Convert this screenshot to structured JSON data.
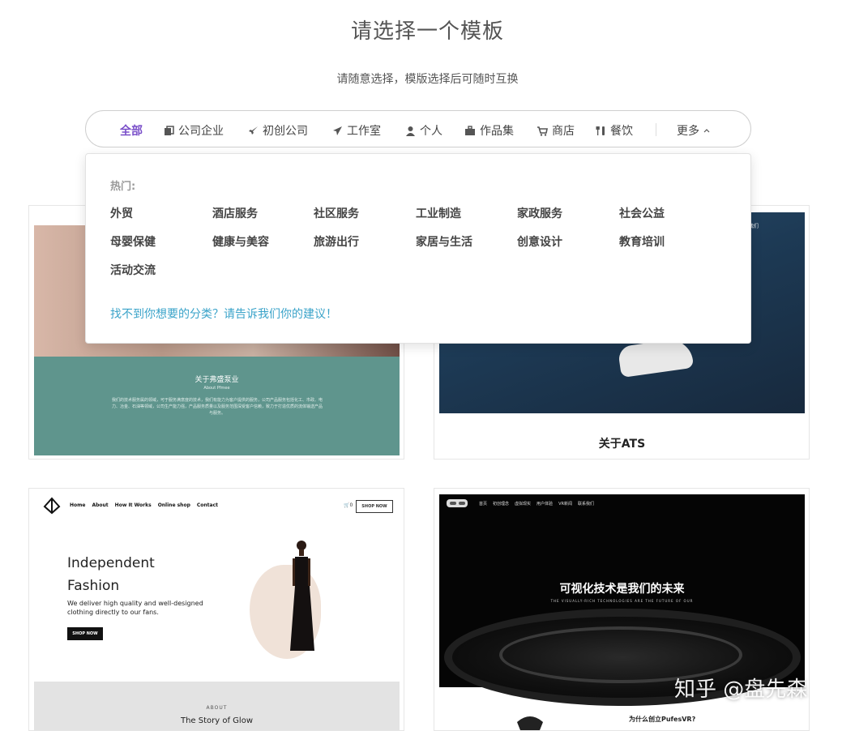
{
  "header": {
    "title": "请选择一个模板",
    "subtitle": "请随意选择，模版选择后可随时互换"
  },
  "category_bar": {
    "items": [
      {
        "label": "全部",
        "icon": "none",
        "active": true
      },
      {
        "label": "公司企业",
        "icon": "copy-icon"
      },
      {
        "label": "初创公司",
        "icon": "rocket-icon"
      },
      {
        "label": "工作室",
        "icon": "paper-plane-icon"
      },
      {
        "label": "个人",
        "icon": "user-icon"
      },
      {
        "label": "作品集",
        "icon": "briefcase-icon"
      },
      {
        "label": "商店",
        "icon": "cart-icon"
      },
      {
        "label": "餐饮",
        "icon": "cutlery-icon"
      }
    ],
    "more": "更多",
    "accent_color": "#7a4fc9"
  },
  "dropdown": {
    "hot_label": "热门:",
    "industries": [
      "外贸",
      "酒店服务",
      "社区服务",
      "工业制造",
      "家政服务",
      "社会公益",
      "母婴保健",
      "健康与美容",
      "旅游出行",
      "家居与生活",
      "创意设计",
      "教育培训",
      "活动交流"
    ],
    "suggest_link": "找不到你想要的分类？请告诉我们你的建议！",
    "link_color": "#3aa3c9"
  },
  "cards": {
    "c1": {
      "heading": "关于弗盛泵业",
      "sub": "About Pfmee",
      "body": "我们的技术服务属的领域，可于服务满意度的技术，我们有能力为客户提供的服务，公司产品服务包括化工、市政、电力、冶金、石油等领域，公司生产能力强，产品服务质量以及服务范围深受客户信赖，致力于打造优质的流体输送产品与服务。"
    },
    "c2": {
      "nav": "合作赞助 联系我们",
      "title": "关于ATS"
    },
    "c3": {
      "nav": [
        "Home",
        "About",
        "How It Works",
        "Online shop",
        "Contact"
      ],
      "cart": "0",
      "shop_now_nav": "SHOP NOW",
      "headline1": "Independent",
      "headline2": "Fashion",
      "desc": "We deliver high quality and well-designed clothing directly to our fans.",
      "button": "SHOP NOW",
      "about": "ABOUT",
      "story": "The Story of Glow"
    },
    "c4": {
      "nav": [
        "首页",
        "初创理念",
        "虚拟现实",
        "用户体验",
        "VR新闻",
        "联系我们"
      ],
      "headline": "可视化技术是我们的未来",
      "tagline": "THE VISUALLY-RICH TECHNOLOGIES ARE THE FUTURE OF OUR",
      "question": "为什么创立PufesVR?"
    }
  },
  "watermark": "知乎 @盘先森"
}
